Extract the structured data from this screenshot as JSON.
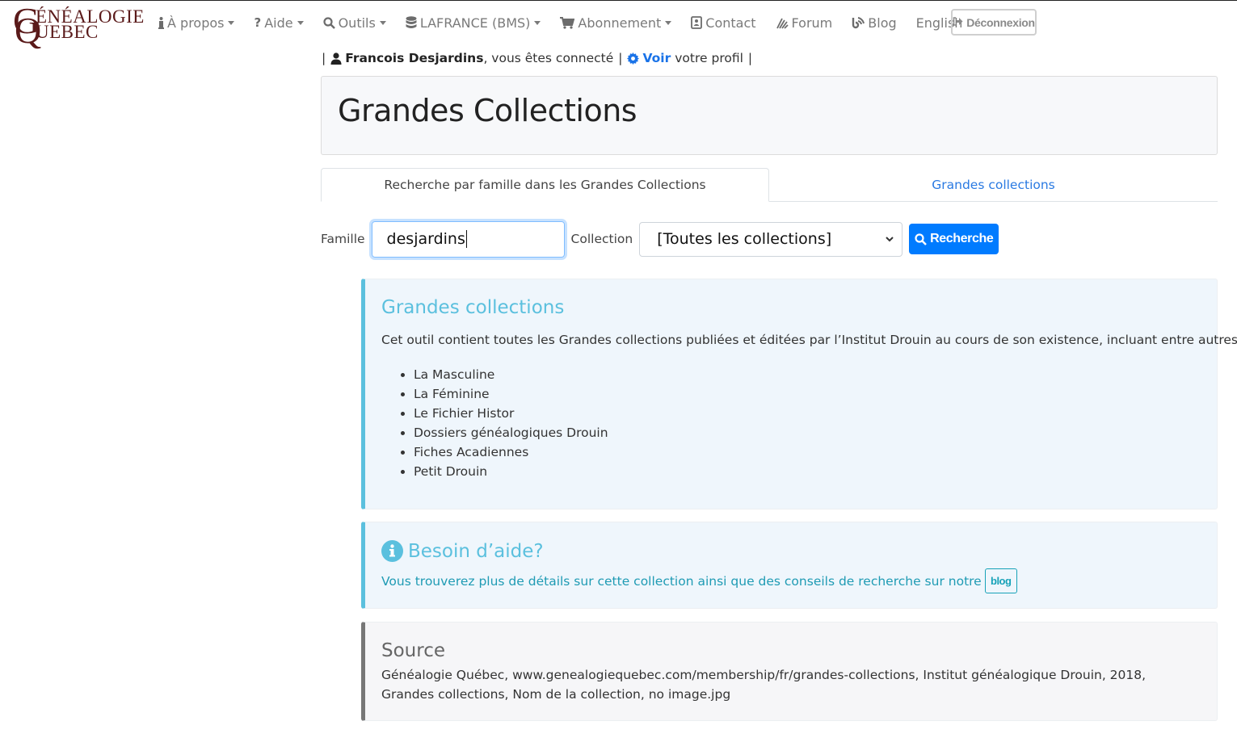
{
  "brand": {
    "logo_initials": [
      "G",
      "Q"
    ],
    "logo_line1": "ÉNÉALOGIE",
    "logo_line2": "UEBEC",
    "logo_color": "#5a1a1a"
  },
  "nav": {
    "items": [
      {
        "label": "À propos",
        "icon": "info-icon",
        "dropdown": true
      },
      {
        "label": "Aide",
        "icon": "question-icon",
        "dropdown": true
      },
      {
        "label": "Outils",
        "icon": "search-icon",
        "dropdown": true
      },
      {
        "label": "LAFRANCE (BMS)",
        "icon": "database-icon",
        "dropdown": true
      },
      {
        "label": "Abonnement",
        "icon": "cart-icon",
        "dropdown": true
      },
      {
        "label": "Contact",
        "icon": "contact-card-icon",
        "dropdown": false
      },
      {
        "label": "Forum",
        "icon": "forum-icon",
        "dropdown": false
      },
      {
        "label": "Blog",
        "icon": "blog-icon",
        "dropdown": false
      },
      {
        "label": "English",
        "icon": null,
        "dropdown": false
      }
    ],
    "logout_label": "Déconnexion"
  },
  "user": {
    "sep": "|",
    "name": "Francois Desjardins",
    "connected_text": ", vous êtes connecté",
    "view_link": "Voir",
    "profile_text": "votre profil"
  },
  "page": {
    "title": "Grandes Collections"
  },
  "tabs": [
    {
      "label": "Recherche par famille dans les Grandes Collections",
      "active": true
    },
    {
      "label": "Grandes collections",
      "active": false
    }
  ],
  "search": {
    "family_label": "Famille",
    "family_value": "desjardins",
    "collection_label": "Collection",
    "collection_selected": "[Toutes les collections]",
    "button_label": "Recherche"
  },
  "info": {
    "title": "Grandes collections",
    "description": "Cet outil contient toutes les Grandes collections publiées et éditées par l’Institut Drouin au cours de son existence, incluant entre autres:",
    "collections": [
      "La Masculine",
      "La Féminine",
      "Le Fichier Histor",
      "Dossiers généalogiques Drouin",
      "Fiches Acadiennes",
      "Petit Drouin"
    ]
  },
  "help": {
    "title": "Besoin d’aide?",
    "text": "Vous trouverez plus de détails sur cette collection ainsi que des conseils de recherche sur notre",
    "blog_label": "blog"
  },
  "source": {
    "title": "Source",
    "citation": "Généalogie Québec, www.genealogiequebec.com/membership/fr/grandes-collections, Institut généalogique Drouin, 2018, Grandes collections, Nom de la collection, no image.jpg"
  },
  "colors": {
    "primary": "#007bff",
    "link": "#2a7ae2",
    "info": "#5bc0de",
    "info_text": "#1f9bb4",
    "info_bg": "#eff6fc",
    "source_bar": "#777777"
  }
}
